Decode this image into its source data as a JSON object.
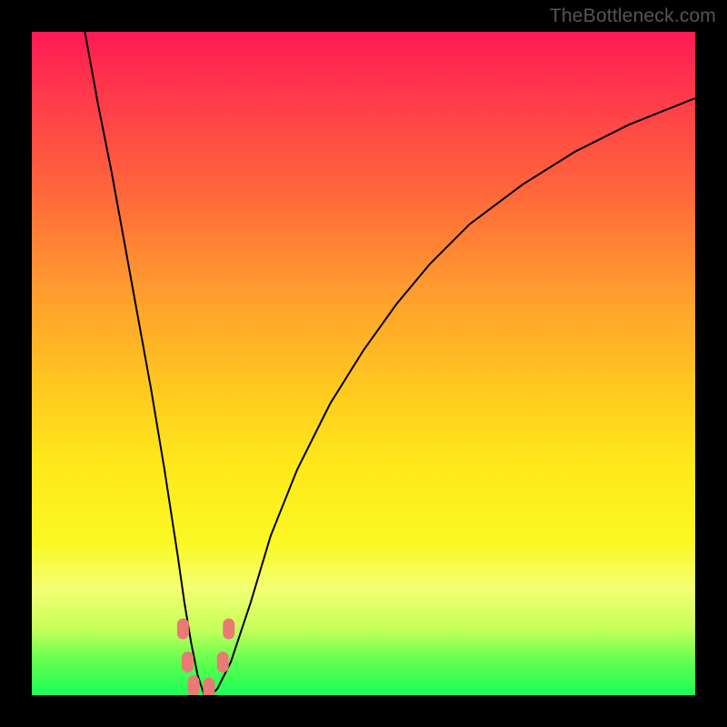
{
  "watermark": "TheBottleneck.com",
  "chart_data": {
    "type": "line",
    "title": "",
    "xlabel": "",
    "ylabel": "",
    "xlim": [
      0,
      100
    ],
    "ylim": [
      0,
      100
    ],
    "series": [
      {
        "name": "bottleneck-curve",
        "x": [
          8,
          10,
          12,
          14,
          16,
          18,
          20,
          22,
          23,
          24,
          25,
          26,
          27,
          28,
          30,
          33,
          36,
          40,
          45,
          50,
          55,
          60,
          66,
          74,
          82,
          90,
          100
        ],
        "y": [
          100,
          89,
          79,
          68,
          57,
          46,
          34,
          21,
          14,
          8,
          3,
          0,
          0,
          1,
          5,
          14,
          24,
          34,
          44,
          52,
          59,
          65,
          71,
          77,
          82,
          86,
          90
        ]
      }
    ],
    "markers": [
      {
        "x": 22.8,
        "y": 10
      },
      {
        "x": 23.5,
        "y": 5
      },
      {
        "x": 24.4,
        "y": 1.4
      },
      {
        "x": 26.7,
        "y": 1.1
      },
      {
        "x": 28.8,
        "y": 5
      },
      {
        "x": 29.7,
        "y": 10
      }
    ],
    "gradient_stops": [
      {
        "pos": 0,
        "color": "#ff1a55"
      },
      {
        "pos": 25,
        "color": "#ff6a3a"
      },
      {
        "pos": 52,
        "color": "#ffc421"
      },
      {
        "pos": 77,
        "color": "#fbf824"
      },
      {
        "pos": 95,
        "color": "#5fff4f"
      },
      {
        "pos": 100,
        "color": "#1bff58"
      }
    ]
  }
}
